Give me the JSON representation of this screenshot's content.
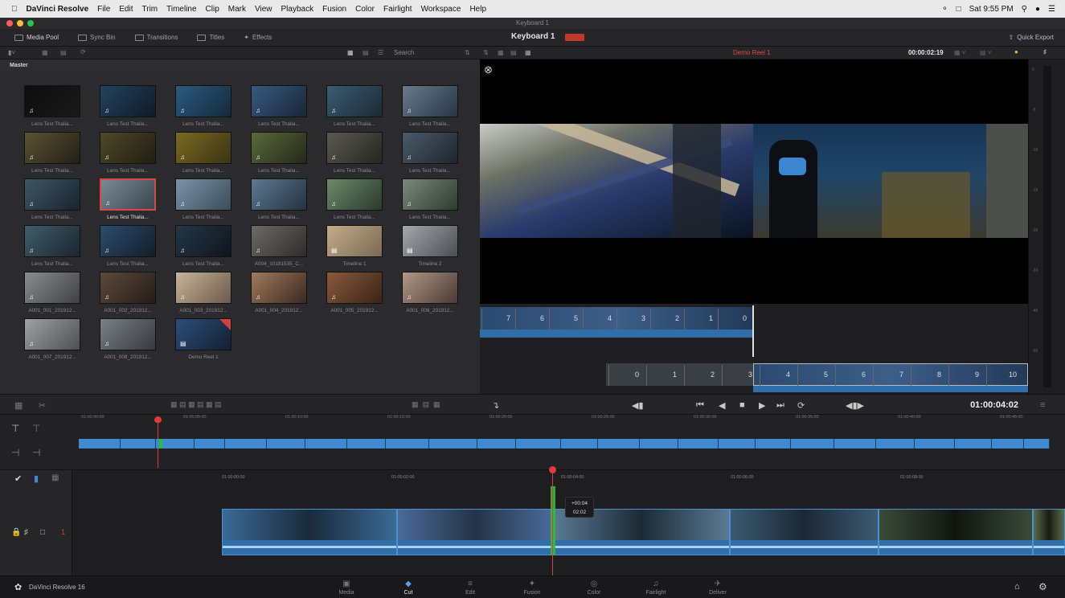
{
  "menubar": {
    "app_name": "DaVinci Resolve",
    "items": [
      "File",
      "Edit",
      "Trim",
      "Timeline",
      "Clip",
      "Mark",
      "View",
      "Playback",
      "Fusion",
      "Color",
      "Fairlight",
      "Workspace",
      "Help"
    ],
    "clock": "Sat 9:55 PM"
  },
  "window": {
    "title": "Keyboard 1"
  },
  "toolbar": {
    "media_pool": "Media Pool",
    "sync_bin": "Sync Bin",
    "transitions": "Transitions",
    "titles": "Titles",
    "effects": "Effects",
    "project_name": "Keyboard 1",
    "quick_export": "Quick Export"
  },
  "pool": {
    "search_label": "Search",
    "bin_name": "Master",
    "clips": [
      {
        "name": "Lens Test Thalia...",
        "colors": [
          "#0d0d0d",
          "#1a1a1a"
        ],
        "audio": true
      },
      {
        "name": "Lens Test Thalia...",
        "colors": [
          "#23425e",
          "#0f1b26"
        ],
        "audio": true
      },
      {
        "name": "Lens Test Thalia...",
        "colors": [
          "#2a5a80",
          "#142a3a"
        ],
        "audio": true
      },
      {
        "name": "Lens Test Thalia...",
        "colors": [
          "#365a80",
          "#1a2636"
        ],
        "audio": true
      },
      {
        "name": "Lens Test Thalia...",
        "colors": [
          "#3b5c72",
          "#1b2a34"
        ],
        "audio": true
      },
      {
        "name": "Lens Test Thalia...",
        "colors": [
          "#6a7b8c",
          "#253545"
        ],
        "audio": true
      },
      {
        "name": "Lens Test Thalia...",
        "colors": [
          "#5a5230",
          "#222018"
        ],
        "audio": true
      },
      {
        "name": "Lens Test Thalia...",
        "colors": [
          "#4d4a26",
          "#1f1e12"
        ],
        "audio": true
      },
      {
        "name": "Lens Test Thalia...",
        "colors": [
          "#7a6a22",
          "#3a3412"
        ],
        "audio": true
      },
      {
        "name": "Lens Test Thalia...",
        "colors": [
          "#5a6a3a",
          "#23281a"
        ],
        "audio": true
      },
      {
        "name": "Lens Test Thalia...",
        "colors": [
          "#5a5a52",
          "#262622"
        ],
        "audio": true
      },
      {
        "name": "Lens Test Thalia...",
        "colors": [
          "#4a5a6a",
          "#1f262c"
        ],
        "audio": true
      },
      {
        "name": "Lens Test Thalia...",
        "colors": [
          "#3e5666",
          "#1a242c"
        ],
        "audio": true
      },
      {
        "name": "Lens Test Thalia...",
        "colors": [
          "#7a8a96",
          "#3a454e"
        ],
        "audio": true,
        "selected": true
      },
      {
        "name": "Lens Test Thalia...",
        "colors": [
          "#7c93a6",
          "#3b4c5a"
        ],
        "audio": true
      },
      {
        "name": "Lens Test Thalia...",
        "colors": [
          "#5e7a92",
          "#24323e"
        ],
        "audio": true
      },
      {
        "name": "Lens Test Thalia...",
        "colors": [
          "#6c8a6a",
          "#2a3a2c"
        ],
        "audio": true
      },
      {
        "name": "Lens Test Thalia...",
        "colors": [
          "#7a8a7a",
          "#2e3a30"
        ],
        "audio": true
      },
      {
        "name": "Lens Test Thalia...",
        "colors": [
          "#405d6e",
          "#1a262c"
        ],
        "audio": true
      },
      {
        "name": "Lens Test Thalia...",
        "colors": [
          "#2c4c6e",
          "#121e2a"
        ],
        "audio": true
      },
      {
        "name": "Lens Test Thalia...",
        "colors": [
          "#233648",
          "#0f161c"
        ],
        "audio": true
      },
      {
        "name": "A004_10181535_C...",
        "colors": [
          "#6e6a66",
          "#2e2c2a"
        ],
        "audio": true
      },
      {
        "name": "Timeline 1",
        "colors": [
          "#c2ac8a",
          "#7a6a52"
        ],
        "audio": false,
        "timeline": true
      },
      {
        "name": "Timeline 2",
        "colors": [
          "#a4a8ac",
          "#4a4e52"
        ],
        "audio": false,
        "timeline": true
      },
      {
        "name": "A001_001_201912...",
        "colors": [
          "#8a8c8e",
          "#3e4042"
        ],
        "audio": true
      },
      {
        "name": "A001_002_201912...",
        "colors": [
          "#5c4a3a",
          "#241c16"
        ],
        "audio": true
      },
      {
        "name": "A001_003_201912...",
        "colors": [
          "#c8b49a",
          "#6a5a4a"
        ],
        "audio": true
      },
      {
        "name": "A001_004_201912...",
        "colors": [
          "#a07a5a",
          "#3a2a22"
        ],
        "audio": true
      },
      {
        "name": "A001_005_201912...",
        "colors": [
          "#8a5a3a",
          "#3a2418"
        ],
        "audio": true
      },
      {
        "name": "A001_006_201912...",
        "colors": [
          "#b09886",
          "#4a3a34"
        ],
        "audio": true
      },
      {
        "name": "A001_007_201912...",
        "colors": [
          "#9ea2a4",
          "#4c5052"
        ],
        "audio": true
      },
      {
        "name": "A001_008_201912...",
        "colors": [
          "#7a8086",
          "#363a3e"
        ],
        "audio": true
      },
      {
        "name": "Demo Reel 1",
        "colors": [
          "#2c4e7a",
          "#142030"
        ],
        "audio": false,
        "timeline": true,
        "flag": true
      }
    ]
  },
  "viewer": {
    "timeline_name": "Demo Reel 1",
    "source_timecode": "00:00:02:19",
    "frames_upper": [
      "7",
      "6",
      "5",
      "4",
      "3",
      "2",
      "1",
      "0"
    ],
    "frames_lower": [
      "0",
      "1",
      "2",
      "3",
      "4",
      "5",
      "6",
      "7",
      "8",
      "9",
      "10"
    ],
    "meter_ticks": [
      "0",
      "-5",
      "-10",
      "-15",
      "-20",
      "-30",
      "-40",
      "-50"
    ]
  },
  "transport": {
    "timecode": "01:00:04:02"
  },
  "upper_timeline": {
    "ticks": [
      "01:00:00:00",
      "01:00:05:00",
      "01:00:10:00",
      "01:00:15:00",
      "01:00:20:00",
      "01:00:25:00",
      "01:00:30:00",
      "01:00:35:00",
      "01:00:40:00",
      "01:00:45:00"
    ]
  },
  "lower_timeline": {
    "ticks": [
      "01:00:00:00",
      "01:00:02:00",
      "01:00:04:00",
      "01:00:06:00",
      "01:00:08:00"
    ],
    "track_number": "1",
    "tooltip_offset": "+00:04",
    "tooltip_duration": "02:02",
    "clips": [
      {
        "colors": [
          "#3a6a96",
          "#1a2a3a"
        ]
      },
      {
        "colors": [
          "#4a6a9a",
          "#243446"
        ]
      },
      {
        "colors": [
          "#5a7a94",
          "#1c2a36"
        ]
      },
      {
        "colors": [
          "#3a5a72",
          "#1c2834"
        ]
      },
      {
        "colors": [
          "#3a4a3a",
          "#10160e"
        ]
      },
      {
        "colors": [
          "#5a6a4a",
          "#1a1c14"
        ]
      }
    ]
  },
  "pages": [
    "Media",
    "Cut",
    "Edit",
    "Fusion",
    "Color",
    "Fairlight",
    "Deliver"
  ],
  "footer": {
    "brand": "DaVinci Resolve 16"
  },
  "colors": {
    "accent_blue": "#3f8ad0",
    "playhead_red": "#e23a3a",
    "clip_flag_red": "#d84040"
  }
}
